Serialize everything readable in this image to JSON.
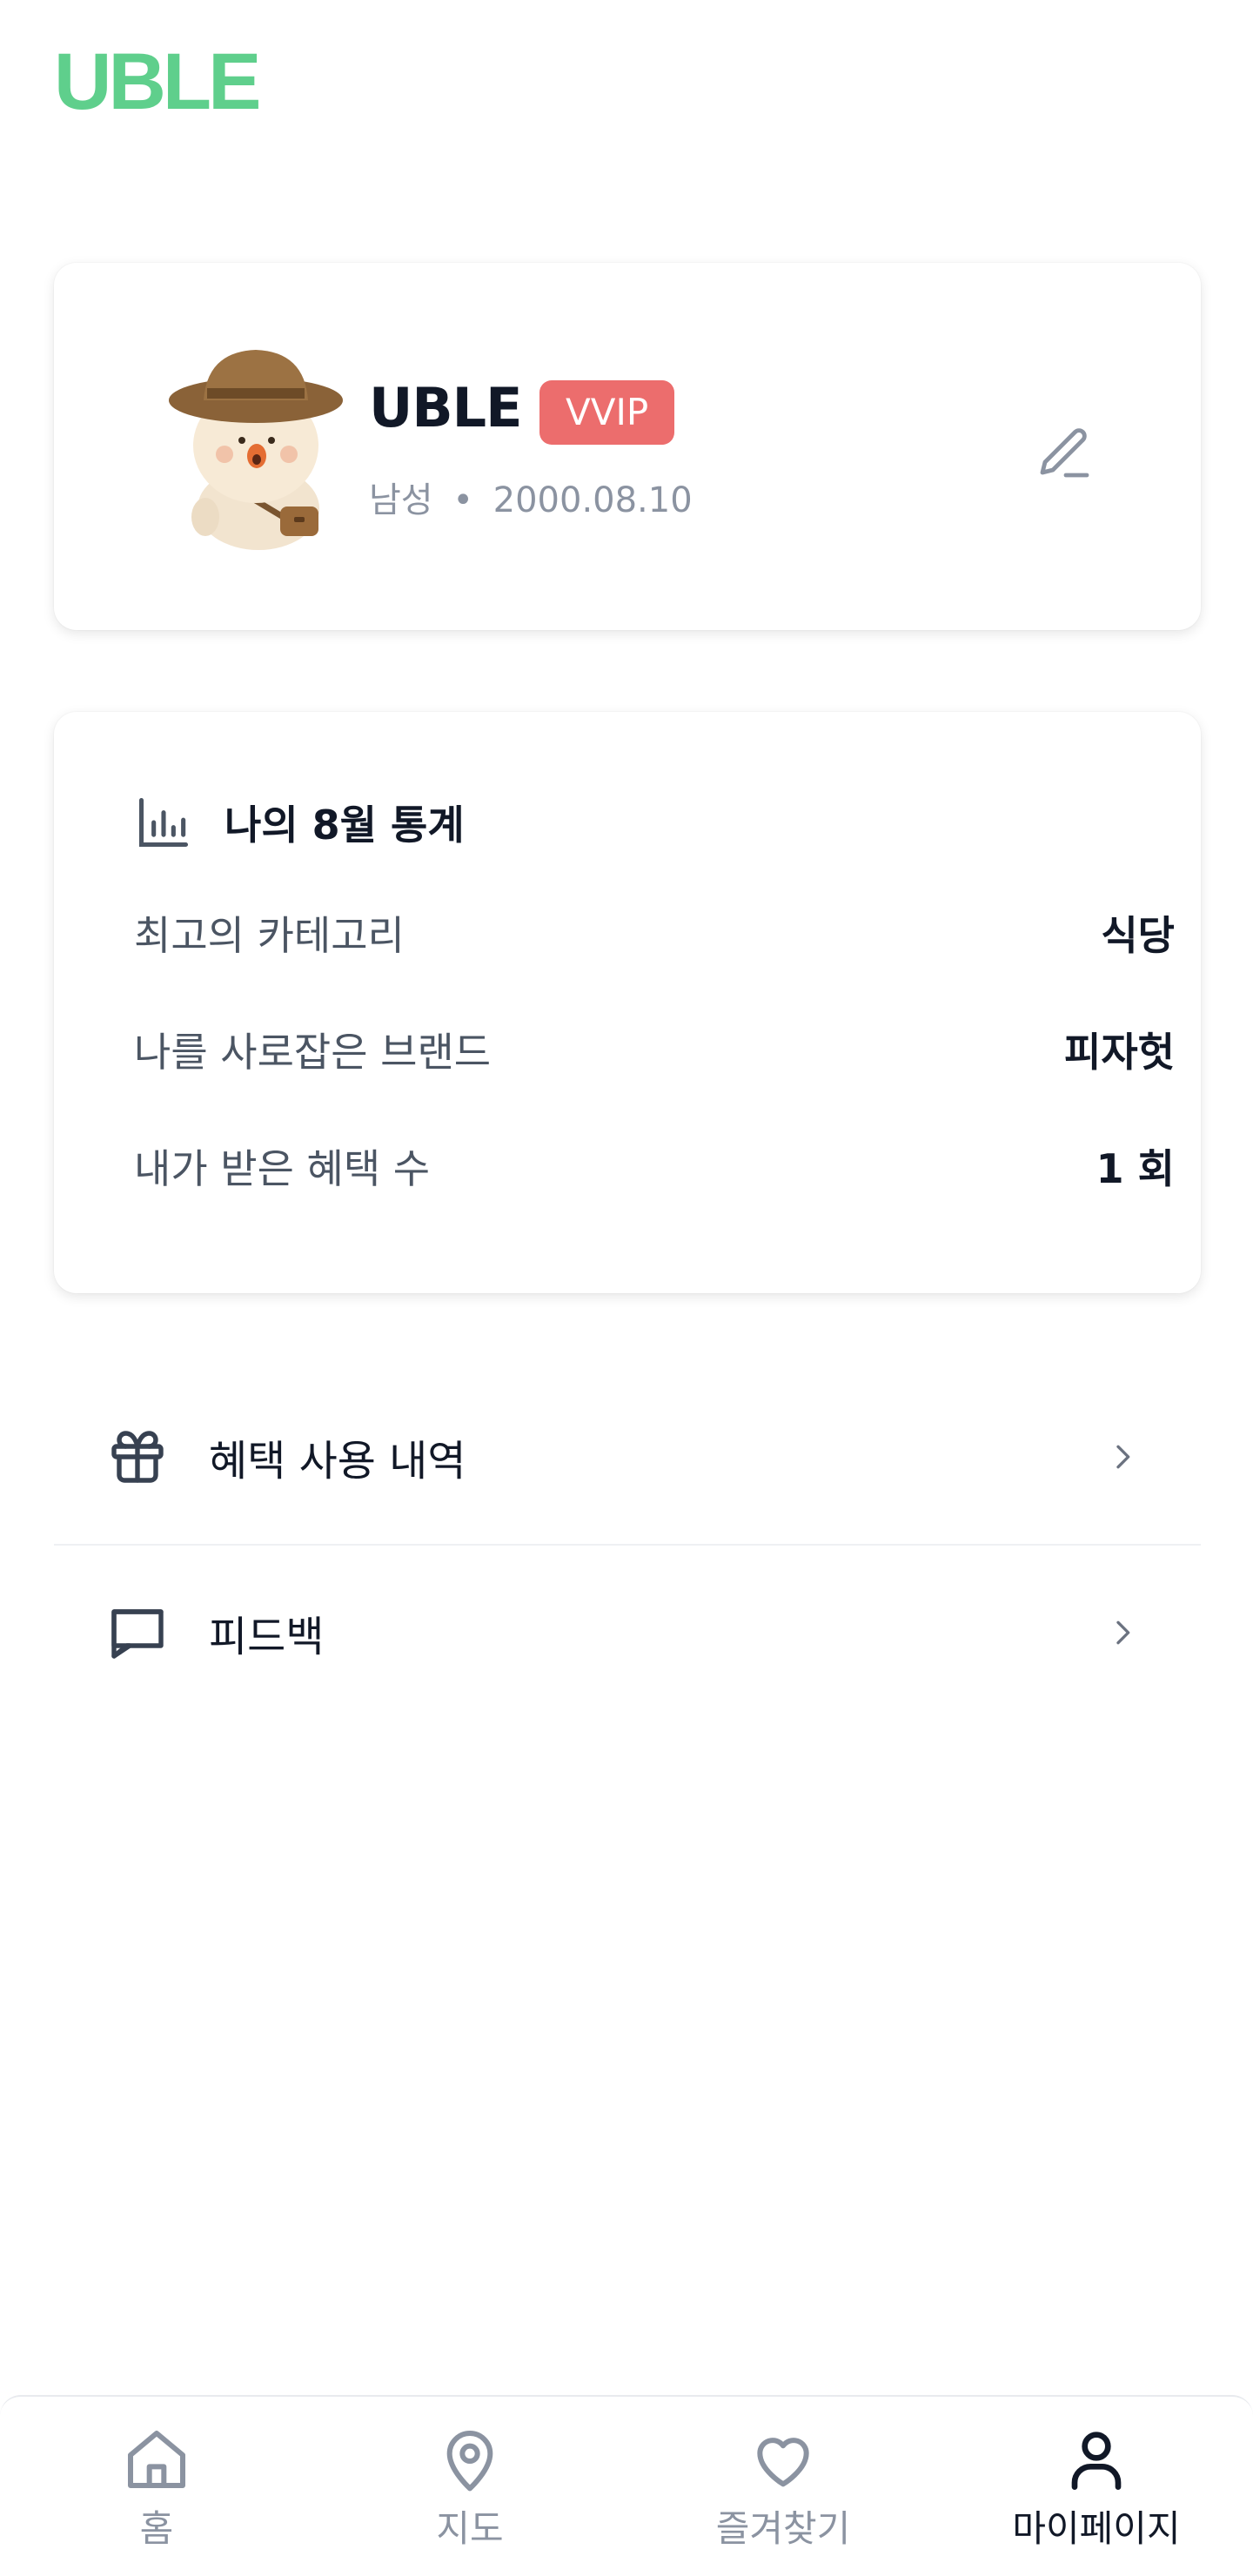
{
  "app": {
    "logo": "UBLE",
    "logo_color": "#5fcf8c"
  },
  "profile": {
    "name": "UBLE",
    "badge": "VVIP",
    "badge_color": "#ec6d6d",
    "gender": "남성",
    "separator": "•",
    "birthdate": "2000.08.10",
    "avatar_icon": "explorer-character-avatar",
    "edit_icon": "pencil-icon"
  },
  "stats": {
    "title": "나의 8월 통계",
    "title_icon": "bar-chart-icon",
    "rows": [
      {
        "label": "최고의 카테고리",
        "value": "식당"
      },
      {
        "label": "나를 사로잡은 브랜드",
        "value": "피자헛"
      },
      {
        "label": "내가 받은 혜택 수",
        "value": "1 회"
      }
    ]
  },
  "menu": [
    {
      "label": "혜택 사용 내역",
      "icon": "gift-icon"
    },
    {
      "label": "피드백",
      "icon": "message-square-icon"
    }
  ],
  "nav": {
    "items": [
      {
        "label": "홈",
        "icon": "home-icon"
      },
      {
        "label": "지도",
        "icon": "map-pin-icon"
      },
      {
        "label": "즐겨찾기",
        "icon": "heart-icon"
      },
      {
        "label": "마이페이지",
        "icon": "user-icon"
      }
    ],
    "active": "마이페이지"
  }
}
